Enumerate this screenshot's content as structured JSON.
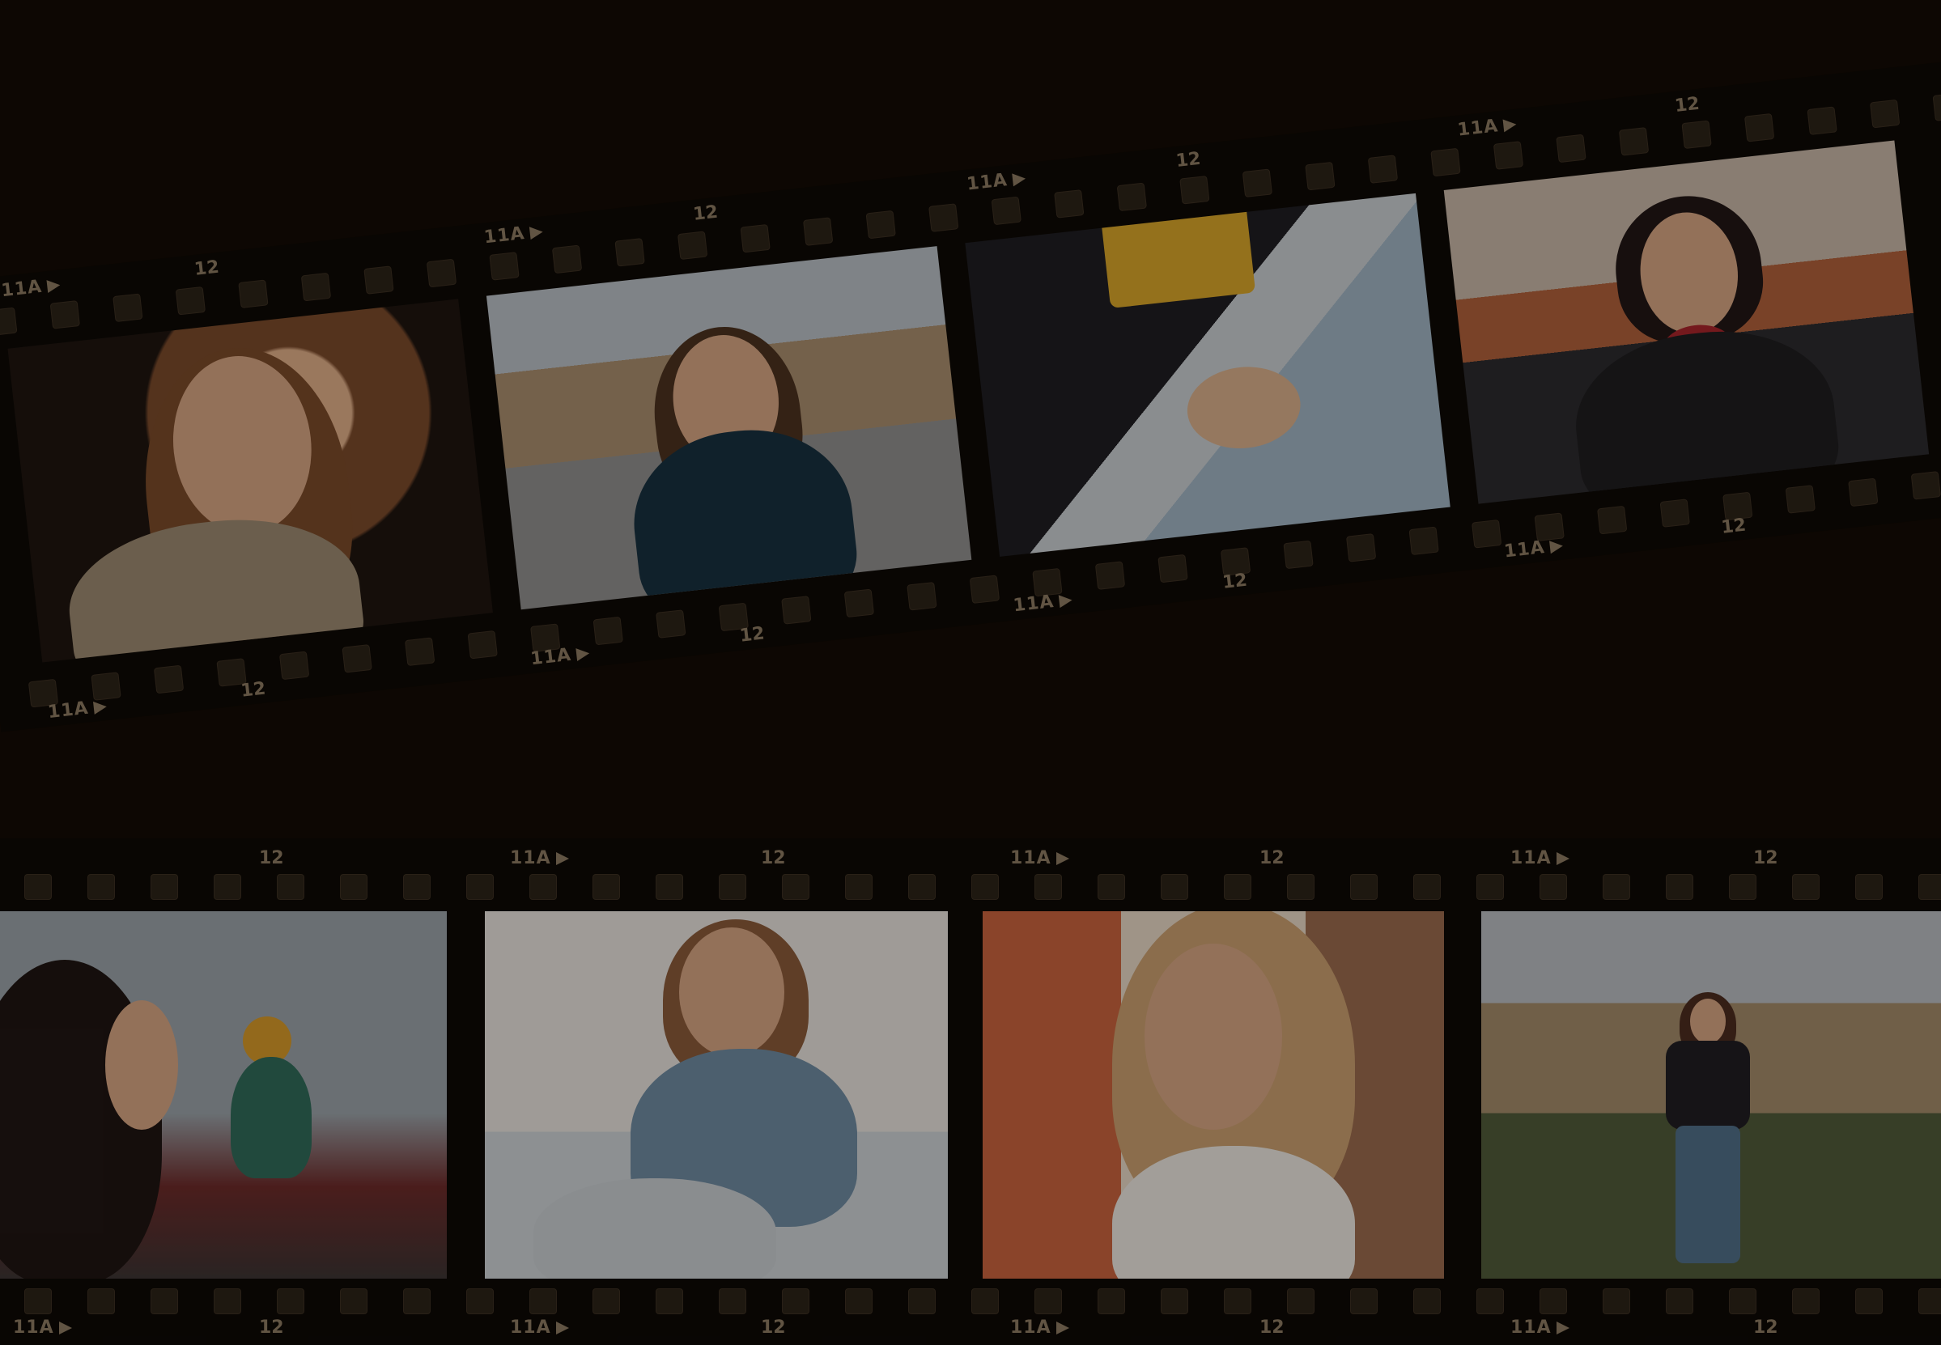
{
  "film": {
    "code_label": "11A",
    "frame_number": "12"
  },
  "photos": [
    "woman with long hair in beige jacket, bokeh lights",
    "woman in dark puffer jacket in town square",
    "couple holding hands, jeans close-up",
    "woman with red bead necklace in front of church",
    "woman smiling, child running in background",
    "woman in blue sweater sitting on sofa",
    "blonde woman in white sweater near red building",
    "woman standing in park in front of buildings"
  ]
}
